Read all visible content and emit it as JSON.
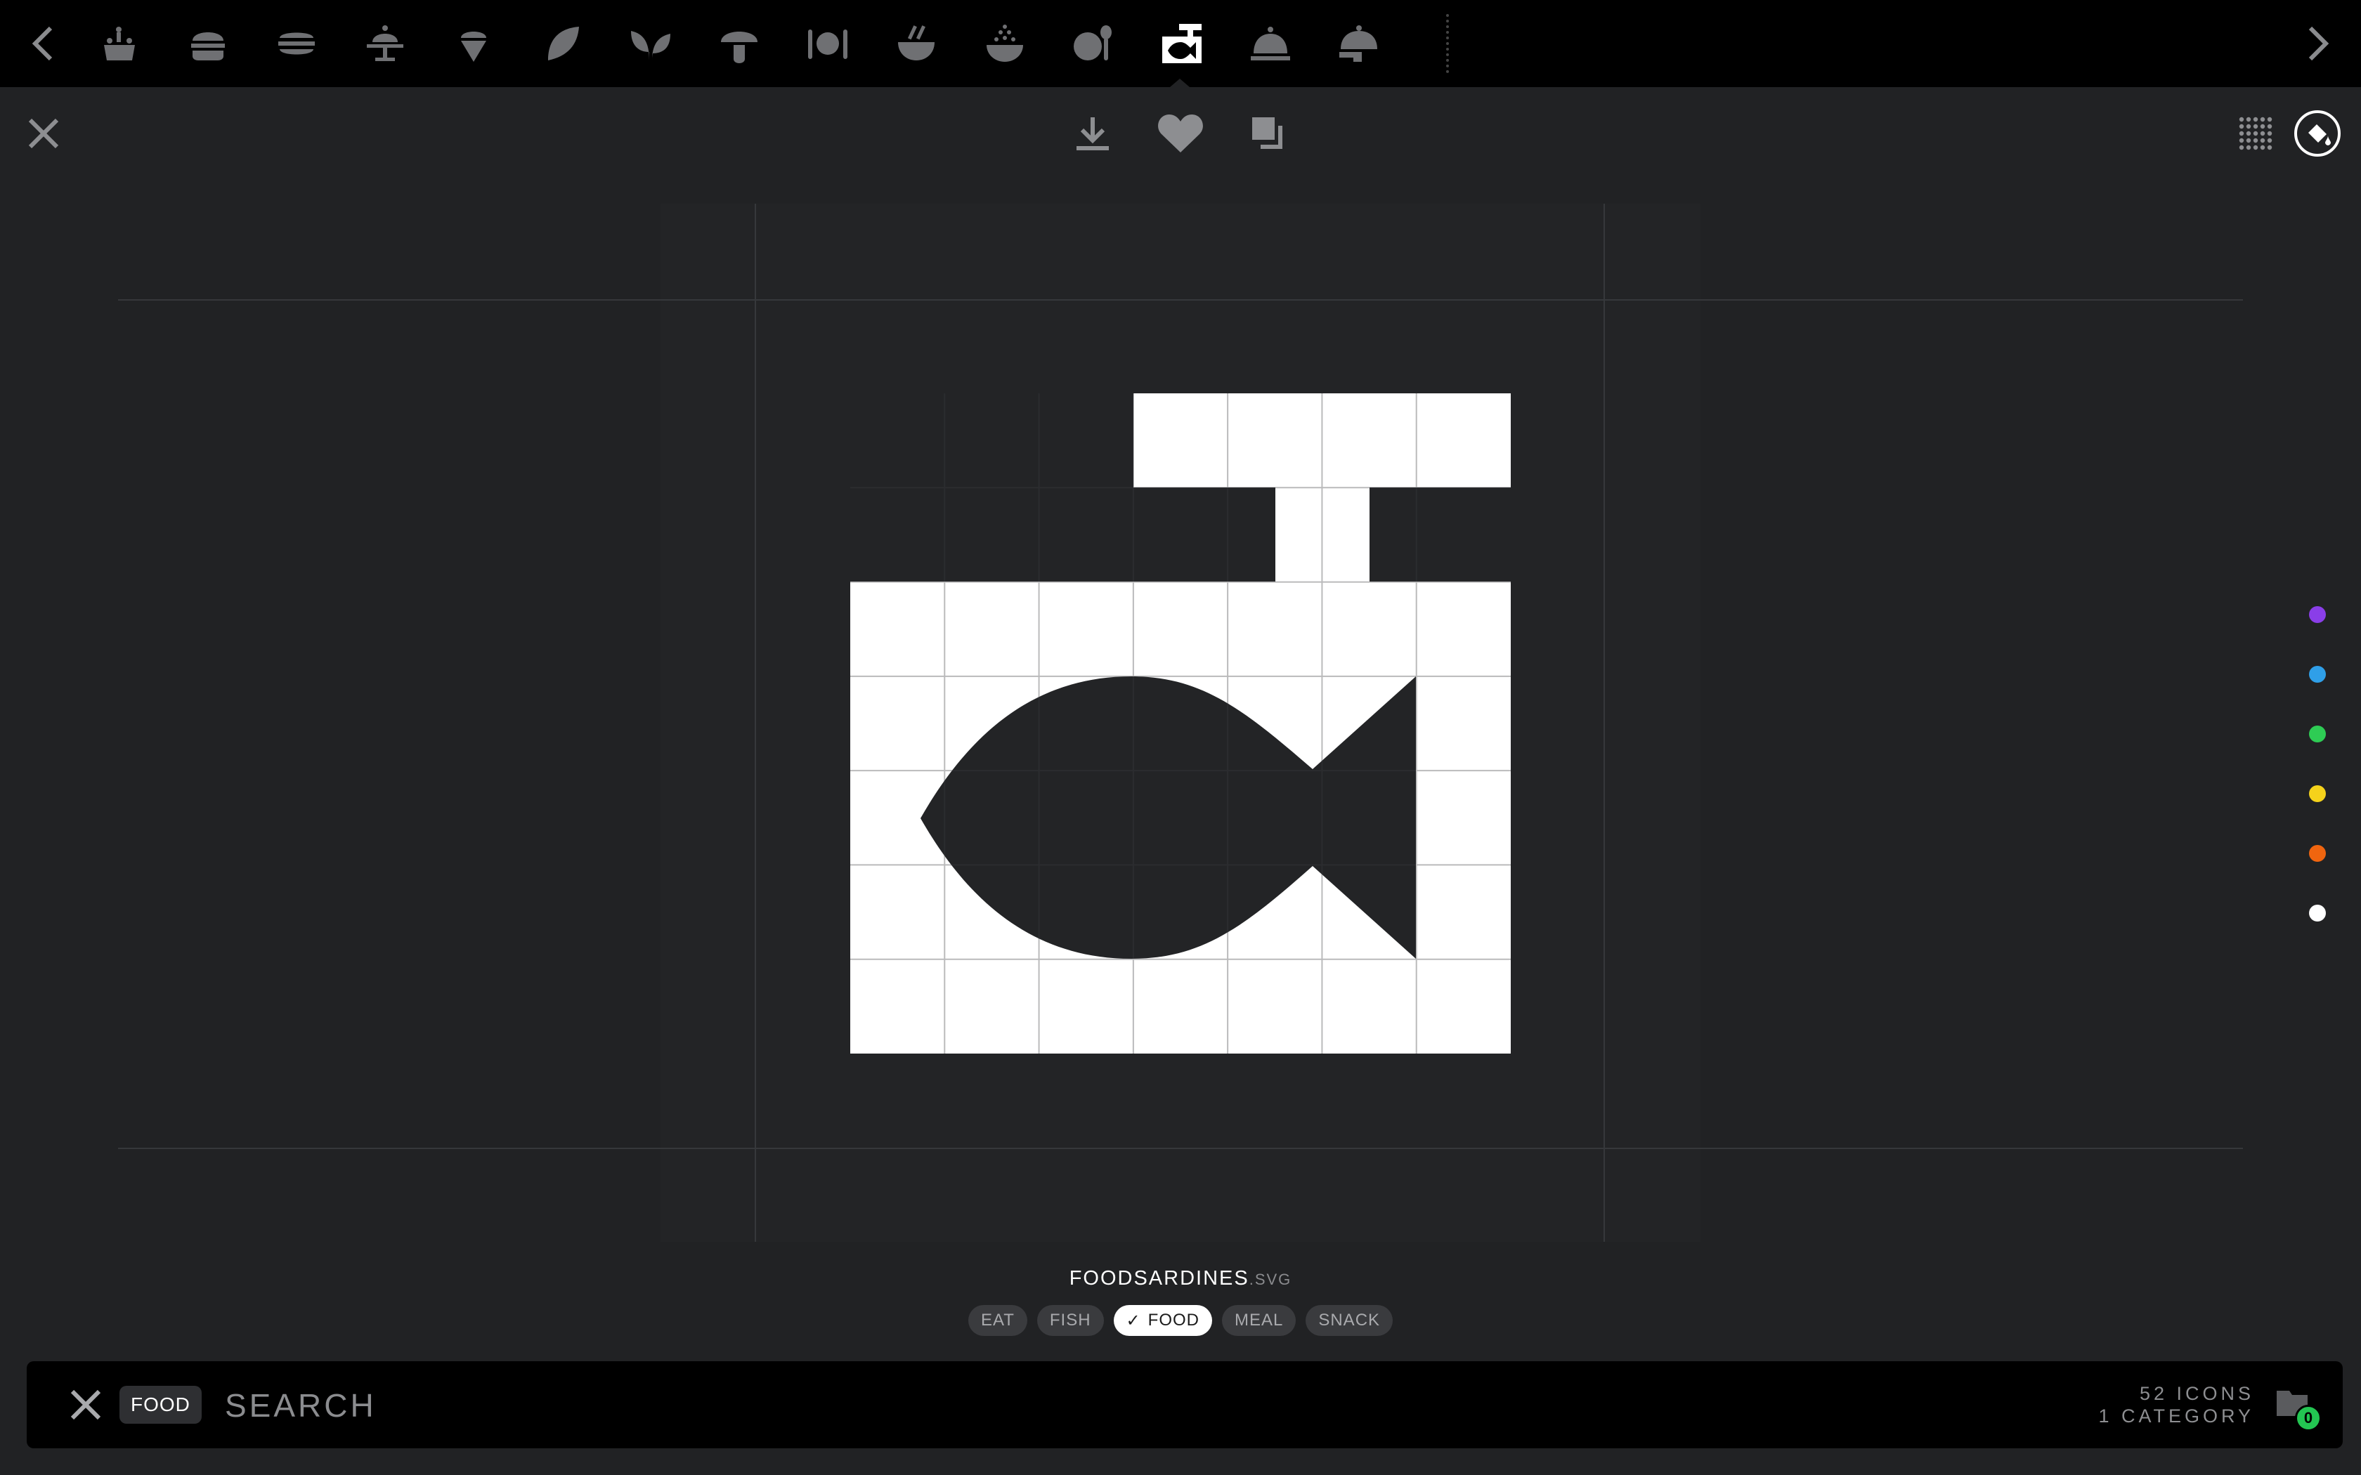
{
  "top_strip": {
    "icons": [
      {
        "name": "cake-icon",
        "active": false
      },
      {
        "name": "burger-icon",
        "active": false
      },
      {
        "name": "sandwich-icon",
        "active": false
      },
      {
        "name": "cupcake-icon",
        "active": false
      },
      {
        "name": "ice-cream-icon",
        "active": false
      },
      {
        "name": "leaf-icon",
        "active": false
      },
      {
        "name": "sprout-icon",
        "active": false
      },
      {
        "name": "mushroom-icon",
        "active": false
      },
      {
        "name": "plate-cutlery-icon",
        "active": false
      },
      {
        "name": "noodle-bowl-icon",
        "active": false
      },
      {
        "name": "rice-bowl-icon",
        "active": false
      },
      {
        "name": "plate-spoon-icon",
        "active": false
      },
      {
        "name": "sardines-can-icon",
        "active": true
      },
      {
        "name": "cloche-icon",
        "active": false
      },
      {
        "name": "serving-tray-icon",
        "active": false
      }
    ]
  },
  "file": {
    "name": "FOODSARDINES",
    "ext": ".SVG"
  },
  "tags": [
    {
      "label": "EAT",
      "active": false
    },
    {
      "label": "FISH",
      "active": false
    },
    {
      "label": "FOOD",
      "active": true
    },
    {
      "label": "MEAL",
      "active": false
    },
    {
      "label": "SNACK",
      "active": false
    }
  ],
  "color_options": [
    "#8a3ee8",
    "#2f9fe8",
    "#2ecc54",
    "#f5d21b",
    "#f0650f",
    "#ffffff"
  ],
  "search": {
    "filter_chip": "FOOD",
    "placeholder": "SEARCH",
    "value": ""
  },
  "counts": {
    "icons": "52 ICONS",
    "categories": "1 CATEGORY"
  },
  "folder_badge": "0",
  "colors": {
    "background": "#212224",
    "bar": "#000000",
    "icon_inactive": "#6f7073",
    "icon_active": "#ffffff"
  }
}
